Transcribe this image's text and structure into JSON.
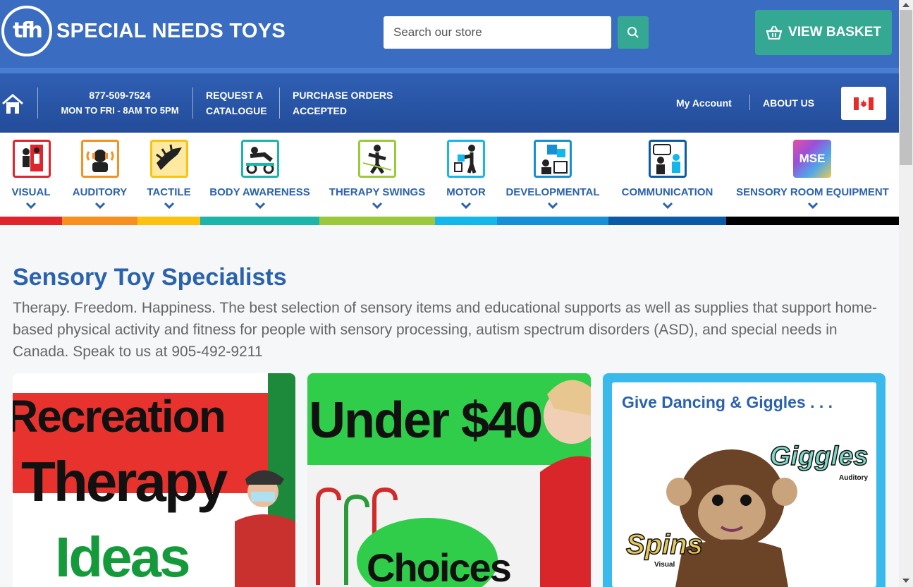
{
  "header": {
    "logo_mark": "tfh",
    "logo_text": "SPECIAL NEEDS TOYS",
    "search_placeholder": "Search our store",
    "basket_label": "VIEW BASKET"
  },
  "nav": {
    "phone": "877-509-7524",
    "hours": "MON TO FRI - 8AM TO 5PM",
    "catalogue_line1": "REQUEST A",
    "catalogue_line2": "CATALOGUE",
    "po_line1": "PURCHASE ORDERS",
    "po_line2": "ACCEPTED",
    "account": "My Account",
    "about": "ABOUT US"
  },
  "categories": [
    {
      "label": "VISUAL",
      "color": "#e0242b",
      "icon": "visual-icon"
    },
    {
      "label": "AUDITORY",
      "color": "#f7901e",
      "icon": "auditory-icon"
    },
    {
      "label": "TACTILE",
      "color": "#fcc20f",
      "icon": "tactile-icon"
    },
    {
      "label": "BODY AWARENESS",
      "color": "#1cb5ac",
      "icon": "body-awareness-icon"
    },
    {
      "label": "THERAPY SWINGS",
      "color": "#9cc93b",
      "icon": "therapy-swings-icon"
    },
    {
      "label": "MOTOR",
      "color": "#14b7ea",
      "icon": "motor-icon"
    },
    {
      "label": "DEVELOPMENTAL",
      "color": "#168fd4",
      "icon": "developmental-icon"
    },
    {
      "label": "COMMUNICATION",
      "color": "#0a5aa5",
      "icon": "communication-icon"
    },
    {
      "label": "SENSORY ROOM EQUIPMENT",
      "color": "#000000",
      "icon": "mse-icon",
      "icon_text": "MSE"
    }
  ],
  "main": {
    "title": "Sensory Toy Specialists",
    "intro": "Therapy. Freedom. Happiness. The best selection of sensory items and educational supports as well as supplies that support home-based physical activity and fitness for people with sensory processing, autism spectrum disorders (ASD), and special needs in Canada. Speak to us at 905-492-9211"
  },
  "cards": [
    {
      "line1": "Recreation",
      "line2": "Therapy",
      "line3": "Ideas"
    },
    {
      "line1": "Under $40",
      "line2": "Choices"
    },
    {
      "heading": "Give Dancing & Giggles . . .",
      "tag1": "Giggles",
      "tag1_sub": "Auditory",
      "tag2": "Spins",
      "tag2_sub": "Visual"
    }
  ],
  "colors": {
    "header_blue": "#3a6cc2",
    "accent_green": "#34a892",
    "title_blue": "#2a62ad"
  }
}
